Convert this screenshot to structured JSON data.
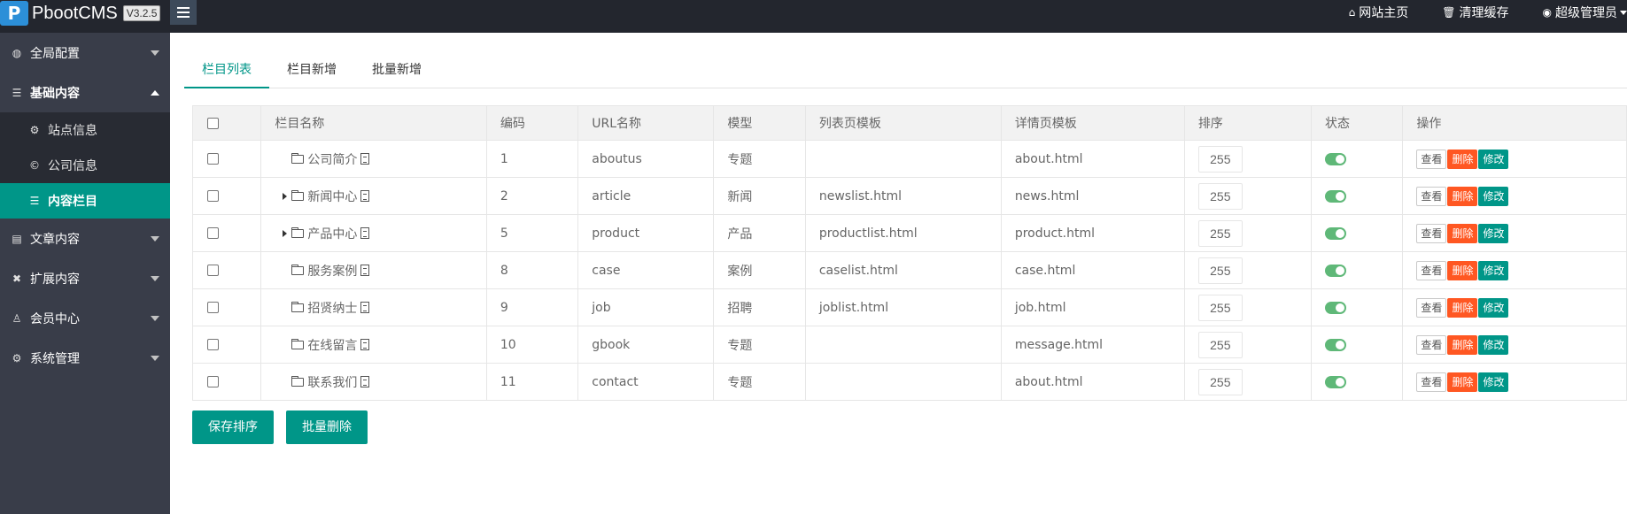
{
  "header": {
    "logo_mark": "P",
    "app_name": "PbootCMS",
    "version": "V3.2.5",
    "links": [
      {
        "icon": "⌂",
        "label": "网站主页"
      },
      {
        "icon": "🗑",
        "label": "清理缓存"
      },
      {
        "icon": "◉",
        "label": "超级管理员"
      }
    ]
  },
  "sidebar": {
    "items": [
      {
        "icon": "◍",
        "label": "全局配置"
      },
      {
        "icon": "☰",
        "label": "基础内容"
      },
      {
        "icon": "▤",
        "label": "文章内容"
      },
      {
        "icon": "✖",
        "label": "扩展内容"
      },
      {
        "icon": "♙",
        "label": "会员中心"
      },
      {
        "icon": "⚙",
        "label": "系统管理"
      }
    ],
    "sub_items": [
      {
        "icon": "⚙",
        "label": "站点信息"
      },
      {
        "icon": "©",
        "label": "公司信息"
      },
      {
        "icon": "☰",
        "label": "内容栏目"
      }
    ]
  },
  "tabs": [
    "栏目列表",
    "栏目新增",
    "批量新增"
  ],
  "table": {
    "headers": [
      "栏目名称",
      "编码",
      "URL名称",
      "模型",
      "列表页模板",
      "详情页模板",
      "排序",
      "状态",
      "操作"
    ],
    "rows": [
      {
        "name": "公司简介",
        "code": "1",
        "url": "aboutus",
        "model": "专题",
        "list_tpl": "",
        "detail_tpl": "about.html",
        "sort": "255",
        "expandable": false
      },
      {
        "name": "新闻中心",
        "code": "2",
        "url": "article",
        "model": "新闻",
        "list_tpl": "newslist.html",
        "detail_tpl": "news.html",
        "sort": "255",
        "expandable": true
      },
      {
        "name": "产品中心",
        "code": "5",
        "url": "product",
        "model": "产品",
        "list_tpl": "productlist.html",
        "detail_tpl": "product.html",
        "sort": "255",
        "expandable": true
      },
      {
        "name": "服务案例",
        "code": "8",
        "url": "case",
        "model": "案例",
        "list_tpl": "caselist.html",
        "detail_tpl": "case.html",
        "sort": "255",
        "expandable": false
      },
      {
        "name": "招贤纳士",
        "code": "9",
        "url": "job",
        "model": "招聘",
        "list_tpl": "joblist.html",
        "detail_tpl": "job.html",
        "sort": "255",
        "expandable": false
      },
      {
        "name": "在线留言",
        "code": "10",
        "url": "gbook",
        "model": "专题",
        "list_tpl": "",
        "detail_tpl": "message.html",
        "sort": "255",
        "expandable": false
      },
      {
        "name": "联系我们",
        "code": "11",
        "url": "contact",
        "model": "专题",
        "list_tpl": "",
        "detail_tpl": "about.html",
        "sort": "255",
        "expandable": false
      }
    ],
    "actions": {
      "view": "查看",
      "delete": "删除",
      "edit": "修改"
    }
  },
  "buttons": {
    "save_sort": "保存排序",
    "batch_delete": "批量删除"
  },
  "colors": {
    "accent": "#009688",
    "danger": "#ff5722",
    "switch_on": "#5fb878",
    "header_bg": "#23262e",
    "sidebar_bg": "#393d49"
  }
}
